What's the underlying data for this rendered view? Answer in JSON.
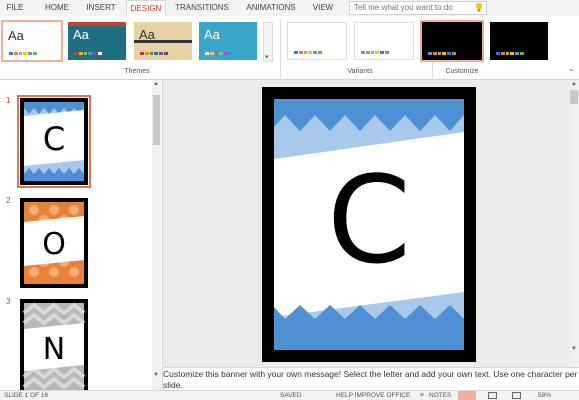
{
  "ribbon_tabs": [
    "FILE",
    "HOME",
    "INSERT",
    "DESIGN",
    "TRANSITIONS",
    "ANIMATIONS",
    "VIEW"
  ],
  "active_tab": "DESIGN",
  "tell_me": {
    "placeholder": "Tell me what you want to do"
  },
  "themes": {
    "group_label": "Themes",
    "items": [
      {
        "label": "Aa",
        "bg": "#ffffff",
        "fg": "#333333"
      },
      {
        "label": "Aa",
        "bg": "#1f6f82",
        "fg": "#ffffff"
      },
      {
        "label": "Aa",
        "bg": "#e6d2a6",
        "fg": "#333333"
      },
      {
        "label": "Aa",
        "bg": "#38a7c9",
        "fg": "#ffffff"
      }
    ]
  },
  "variants": {
    "group_label": "Variants"
  },
  "customize": {
    "group_label": "Customize"
  },
  "slides": [
    {
      "number": "1",
      "letter": "C",
      "pattern": "blue-chevron"
    },
    {
      "number": "2",
      "letter": "O",
      "pattern": "orange-dots"
    },
    {
      "number": "3",
      "letter": "N",
      "pattern": "gray-chevron"
    }
  ],
  "main_slide": {
    "letter": "C"
  },
  "notes": {
    "text": "Customize this banner with your own message! Select the letter and add your own text. Use one character per slide."
  },
  "status": {
    "slide_info": "SLIDE 1 OF 16",
    "saved": "SAVED",
    "help": "HELP IMPROVE OFFICE",
    "notes": "NOTES",
    "zoom": "58%"
  },
  "colors": {
    "accent": "#c43e1c",
    "blue_light": "#a8c8ec",
    "blue_dark": "#4f8fd4",
    "orange": "#e8823a"
  }
}
